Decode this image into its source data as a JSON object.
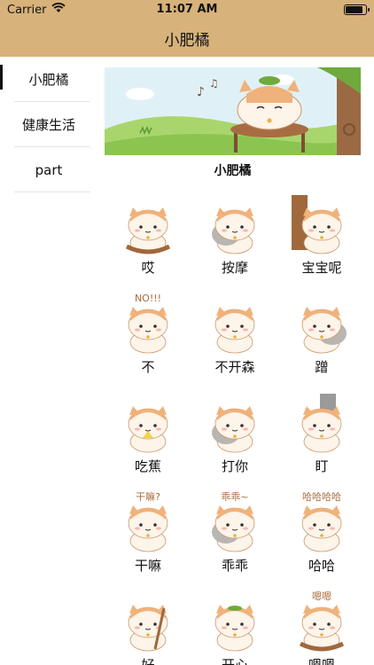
{
  "status_bar": {
    "carrier": "Carrier",
    "time": "11:07 AM",
    "battery_level": 0.9
  },
  "nav": {
    "title": "小肥橘"
  },
  "sidebar": {
    "items": [
      {
        "label": "小肥橘",
        "active": true
      },
      {
        "label": "健康生活",
        "active": false
      },
      {
        "label": "part",
        "active": false
      }
    ]
  },
  "banner": {
    "caption": "小肥橘"
  },
  "stickers": [
    {
      "label": "哎",
      "icon": "cat-on-basket-icon"
    },
    {
      "label": "按摩",
      "icon": "cat-massage-icon"
    },
    {
      "label": "宝宝呢",
      "icon": "cat-behind-door-icon"
    },
    {
      "label": "不",
      "icon": "cat-arms-crossed-icon",
      "caption": "NO!!!"
    },
    {
      "label": "不开森",
      "icon": "cat-unhappy-icon"
    },
    {
      "label": "蹭",
      "icon": "cat-cuddle-icon"
    },
    {
      "label": "吃蕉",
      "icon": "cat-banana-icon"
    },
    {
      "label": "打你",
      "icon": "cat-fight-icon"
    },
    {
      "label": "盯",
      "icon": "cat-peek-icon"
    },
    {
      "label": "干嘛",
      "icon": "cat-what-icon",
      "caption": "干嘛?"
    },
    {
      "label": "乖乖",
      "icon": "cat-pat-icon",
      "caption": "乖乖~"
    },
    {
      "label": "哈哈",
      "icon": "cat-laugh-icon",
      "caption": "哈哈哈哈"
    },
    {
      "label": "好",
      "icon": "cat-broom-icon"
    },
    {
      "label": "开心",
      "icon": "cat-happy-chair-icon"
    },
    {
      "label": "嗯嗯",
      "icon": "cat-nod-icon",
      "caption": "嗯嗯"
    }
  ],
  "colors": {
    "bar": "#d7b27a",
    "cat_orange": "#f0b27a",
    "cat_cream": "#fdf4ea",
    "grey_cat": "#b9b6b2",
    "wood": "#a0683c"
  }
}
